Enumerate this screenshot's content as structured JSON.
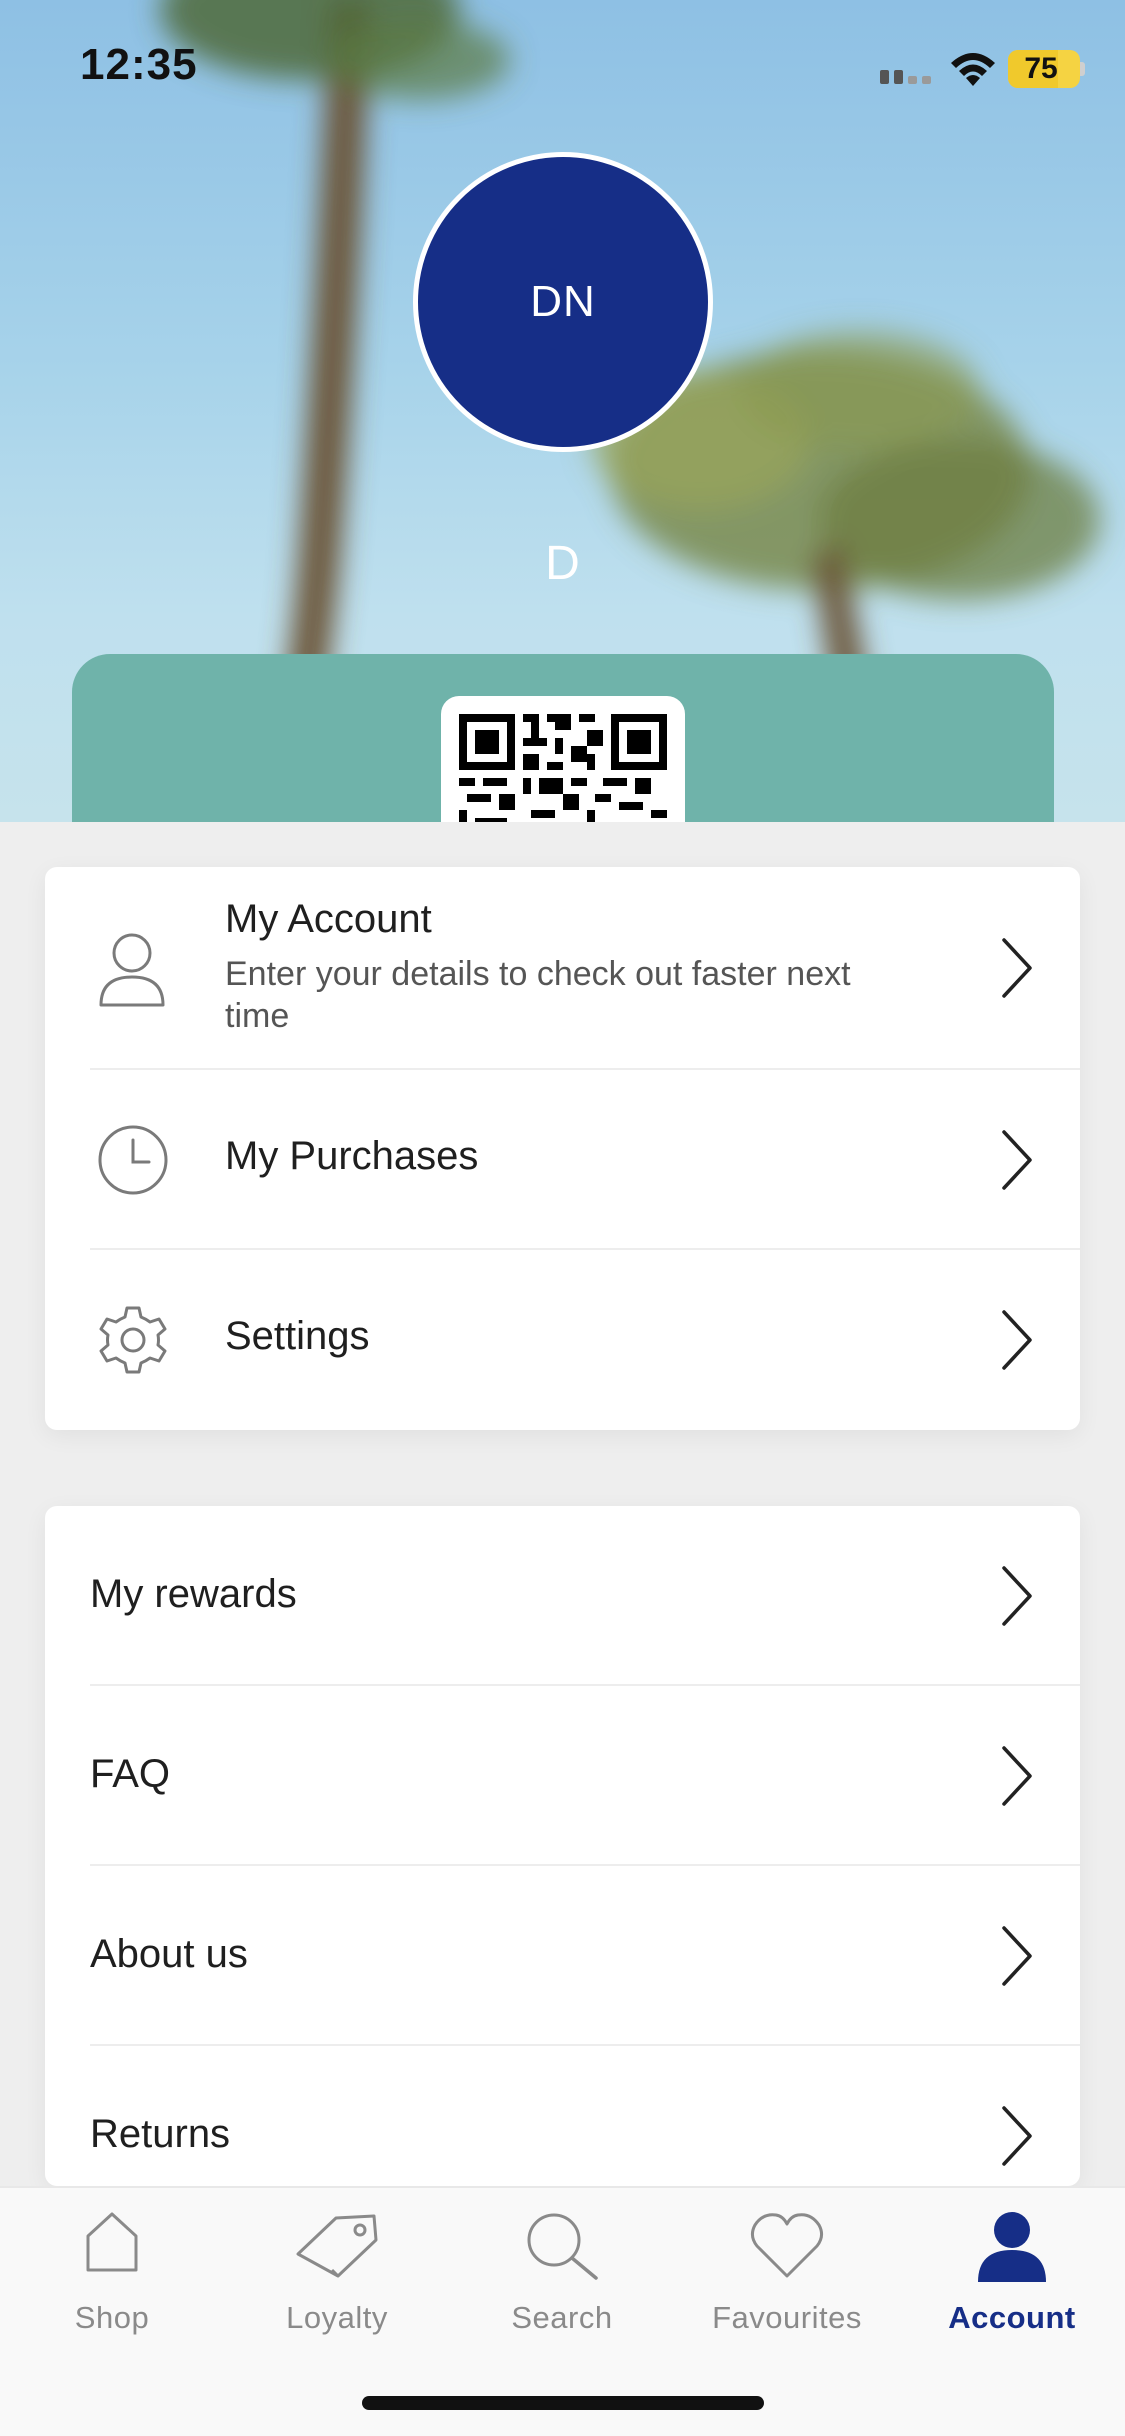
{
  "status_bar": {
    "time": "12:35",
    "battery_percent": "75",
    "battery_level": 0.75,
    "icons": [
      "cellular-signal-icon",
      "wifi-icon",
      "battery-charging-icon"
    ]
  },
  "profile": {
    "initials": "DN",
    "name": "D"
  },
  "account_menu": [
    {
      "title": "My Account",
      "subtitle": "Enter your details to check out faster next time",
      "icon": "user-icon"
    },
    {
      "title": "My Purchases",
      "icon": "clock-icon"
    },
    {
      "title": "Settings",
      "icon": "gear-icon"
    }
  ],
  "info_menu": [
    {
      "title": "My rewards"
    },
    {
      "title": "FAQ"
    },
    {
      "title": "About us"
    },
    {
      "title": "Returns"
    }
  ],
  "tab_bar": {
    "active": "Account",
    "tabs": [
      {
        "label": "Shop",
        "icon": "home-icon"
      },
      {
        "label": "Loyalty",
        "icon": "tag-icon"
      },
      {
        "label": "Search",
        "icon": "search-icon"
      },
      {
        "label": "Favourites",
        "icon": "heart-icon"
      },
      {
        "label": "Account",
        "icon": "person-icon"
      }
    ]
  },
  "colors": {
    "brand_navy": "#162e87",
    "loyalty_card": "#6fb3aa",
    "inactive_tab": "#8a8a8a"
  }
}
